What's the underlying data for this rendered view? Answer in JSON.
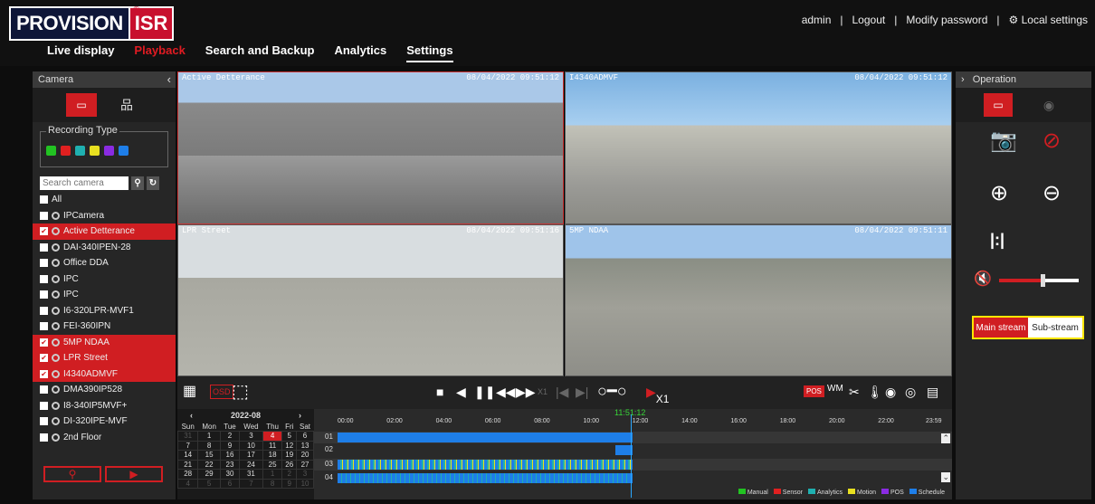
{
  "header": {
    "logo_word": "PROVISION",
    "logo_mark": "ISR",
    "reg": "®",
    "links": [
      "admin",
      "|",
      "Logout",
      "|",
      "Modify password",
      "|",
      "Local settings"
    ]
  },
  "nav": [
    "Live display",
    "Playback",
    "Search and Backup",
    "Analytics",
    "Settings"
  ],
  "left": {
    "title": "Camera",
    "recording_type": "Recording Type",
    "search_placeholder": "Search camera",
    "cameras": [
      {
        "name": "All",
        "checked": false,
        "icon": false
      },
      {
        "name": "IPCamera",
        "checked": false,
        "icon": true
      },
      {
        "name": "Active Detterance",
        "checked": true,
        "icon": true
      },
      {
        "name": "DAI-340IPEN-28",
        "checked": false,
        "icon": true
      },
      {
        "name": "Office DDA",
        "checked": false,
        "icon": true
      },
      {
        "name": "IPC",
        "checked": false,
        "icon": true
      },
      {
        "name": "IPC",
        "checked": false,
        "icon": true
      },
      {
        "name": "I6-320LPR-MVF1",
        "checked": false,
        "icon": true
      },
      {
        "name": "FEI-360IPN",
        "checked": false,
        "icon": true
      },
      {
        "name": "5MP NDAA",
        "checked": true,
        "icon": true
      },
      {
        "name": "LPR Street",
        "checked": true,
        "icon": true
      },
      {
        "name": "I4340ADMVF",
        "checked": true,
        "icon": true
      },
      {
        "name": "DMA390IP528",
        "checked": false,
        "icon": true
      },
      {
        "name": "I8-340IP5MVF+",
        "checked": false,
        "icon": true
      },
      {
        "name": "DI-320IPE-MVF",
        "checked": false,
        "icon": true
      },
      {
        "name": "2nd Floor",
        "checked": false,
        "icon": true
      }
    ]
  },
  "videos": [
    {
      "title": "Active Detterance",
      "ts": "08/04/2022 09:51:12"
    },
    {
      "title": "I4340ADMVF",
      "ts": "08/04/2022 09:51:12"
    },
    {
      "title": "LPR Street",
      "ts": "08/04/2022 09:51:16"
    },
    {
      "title": "5MP NDAA",
      "ts": "08/04/2022 09:51:11"
    }
  ],
  "controls": {
    "osd": "OSD",
    "speed1": "X1",
    "speed2": "X1",
    "pos": "POS"
  },
  "calendar": {
    "month": "2022-08",
    "days": [
      "Sun",
      "Mon",
      "Tue",
      "Wed",
      "Thu",
      "Fri",
      "Sat"
    ],
    "weeks": [
      [
        "31",
        "1",
        "2",
        "3",
        "4",
        "5",
        "6"
      ],
      [
        "7",
        "8",
        "9",
        "10",
        "11",
        "12",
        "13"
      ],
      [
        "14",
        "15",
        "16",
        "17",
        "18",
        "19",
        "20"
      ],
      [
        "21",
        "22",
        "23",
        "24",
        "25",
        "26",
        "27"
      ],
      [
        "28",
        "29",
        "30",
        "31",
        "1",
        "2",
        "3"
      ],
      [
        "4",
        "5",
        "6",
        "7",
        "8",
        "9",
        "10"
      ]
    ],
    "today": "4"
  },
  "timeline": {
    "current": "11:51:12",
    "hours": [
      "00:00",
      "02:00",
      "04:00",
      "06:00",
      "08:00",
      "10:00",
      "12:00",
      "14:00",
      "16:00",
      "18:00",
      "20:00",
      "22:00",
      "23:59"
    ],
    "rows": [
      "01",
      "02",
      "03",
      "04"
    ],
    "legend": [
      {
        "label": "Manual",
        "color": "#22c322"
      },
      {
        "label": "Sensor",
        "color": "#e02020"
      },
      {
        "label": "Analytics",
        "color": "#1fb0b0"
      },
      {
        "label": "Motion",
        "color": "#e8e020"
      },
      {
        "label": "POS",
        "color": "#8a2be2"
      },
      {
        "label": "Schedule",
        "color": "#1e7ee8"
      }
    ]
  },
  "right": {
    "title": "Operation",
    "main_stream": "Main stream",
    "sub_stream": "Sub-stream"
  }
}
